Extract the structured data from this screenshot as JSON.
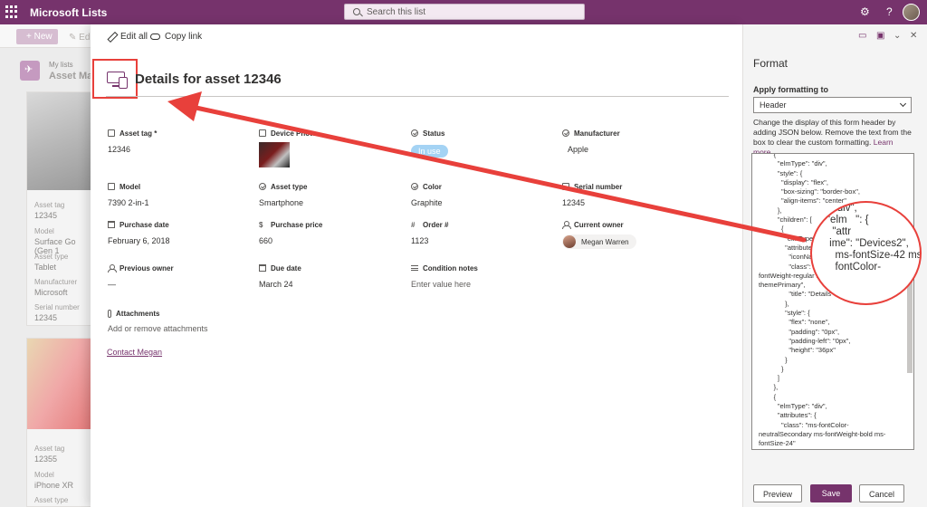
{
  "topbar": {
    "app_name": "Microsoft Lists",
    "search_placeholder": "Search this list",
    "settings_icon": "gear-icon",
    "help_label": "?"
  },
  "background": {
    "new_label": "New",
    "edit_label": "Edi",
    "breadcrumb": "My lists",
    "site_title": "Asset Ma",
    "card1": [
      {
        "label": "Asset tag",
        "value": "12345"
      },
      {
        "label": "Model",
        "value": "Surface Go (Gen 1"
      },
      {
        "label": "Asset type",
        "value": "Tablet"
      },
      {
        "label": "Manufacturer",
        "value": "Microsoft"
      },
      {
        "label": "Serial number",
        "value": "12345"
      }
    ],
    "card2": [
      {
        "label": "Asset tag",
        "value": "12355"
      },
      {
        "label": "Model",
        "value": "iPhone XR"
      },
      {
        "label": "Asset type",
        "value": ""
      }
    ]
  },
  "panel": {
    "edit_all": "Edit all",
    "copy_link": "Copy link",
    "title": "Details for asset 12346",
    "fields": [
      {
        "label": "Asset tag *",
        "value": "12346",
        "icon": "tag-icon"
      },
      {
        "label": "Device Photo",
        "value": "",
        "icon": "camera-icon"
      },
      {
        "label": "Status",
        "value": "In use",
        "icon": "check-circle-icon"
      },
      {
        "label": "Manufacturer",
        "value": "Apple",
        "icon": "check-circle-icon"
      },
      {
        "label": "Model",
        "value": "7390 2-in-1",
        "icon": "tag-icon"
      },
      {
        "label": "Asset type",
        "value": "Smartphone",
        "icon": "check-circle-icon"
      },
      {
        "label": "Color",
        "value": "Graphite",
        "icon": "check-circle-icon"
      },
      {
        "label": "Serial number",
        "value": "12345",
        "icon": "tag-icon"
      },
      {
        "label": "Purchase date",
        "value": "February 6, 2018",
        "icon": "calendar-icon"
      },
      {
        "label": "Purchase price",
        "value": "660",
        "icon": "currency-icon"
      },
      {
        "label": "Order #",
        "value": "1123",
        "icon": "hash-icon"
      },
      {
        "label": "Current owner",
        "value": "Megan Warren",
        "icon": "person-icon"
      },
      {
        "label": "Previous owner",
        "value": "—",
        "icon": "person-icon"
      },
      {
        "label": "Due date",
        "value": "March 24",
        "icon": "calendar-icon"
      },
      {
        "label": "Condition notes",
        "value": "Enter value here",
        "icon": "lines-icon"
      }
    ],
    "attachments_label": "Attachments",
    "attachments_value": "Add or remove attachments",
    "contact_link": "Contact Megan"
  },
  "format_pane": {
    "title": "Format",
    "apply_label": "Apply formatting to",
    "apply_value": "Header",
    "description": "Change the display of this form header by adding JSON below. Remove the text from the box to clear the custom formatting.",
    "learn_more": "Learn more.",
    "code": "        {\n          \"elmType\": \"div\",\n          \"style\": {\n            \"display\": \"flex\",\n            \"box-sizing\": \"border-box\",\n            \"align-items\": \"center\"\n          },\n          \"children\": [\n            {\n              \"elmType\": \"div\",\n              \"attributes\": {\n                \"iconName\": \"Devices2\",\n                \"class\": \"ms-fontSize-42 ms-\nfontWeight-regular ms-fontColor-\nthemePrimary\",\n                \"title\": \"Details\"\n              },\n              \"style\": {\n                \"flex\": \"none\",\n                \"padding\": \"0px\",\n                \"padding-left\": \"0px\",\n                \"height\": \"36px\"\n              }\n            }\n          ]\n        },\n        {\n          \"elmType\": \"div\",\n          \"attributes\": {\n            \"class\": \"ms-fontColor-\nneutralSecondary ms-fontWeight-bold ms-\nfontSize-24\"\n          },\n          \"style\": {",
    "zoom_text": "        'div\",\n     \"elm   \": {\n       \"attr\n      ime\": \"Devices2\",\n        ms-fontSize-42 ms-\n        fontColor-",
    "preview": "Preview",
    "save": "Save",
    "cancel": "Cancel"
  },
  "colors": {
    "brand": "#76336c",
    "annotation": "#e8403b",
    "status_pill": "#a4d3f4"
  }
}
